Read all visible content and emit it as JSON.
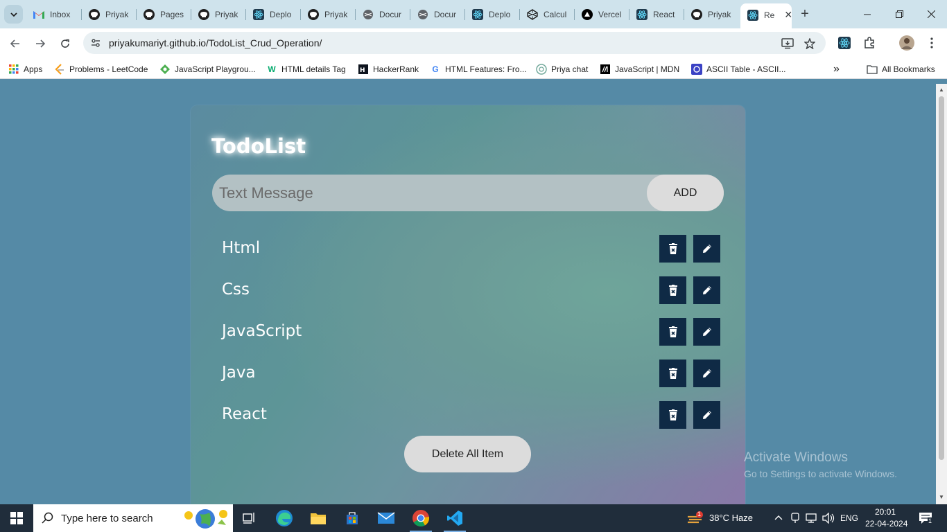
{
  "browser": {
    "tabs": [
      {
        "label": "Inbox",
        "icon": "gmail-icon"
      },
      {
        "label": "Priyak",
        "icon": "github-icon"
      },
      {
        "label": "Pages",
        "icon": "github-icon"
      },
      {
        "label": "Priyak",
        "icon": "github-icon"
      },
      {
        "label": "Deplo",
        "icon": "react-icon"
      },
      {
        "label": "Priyak",
        "icon": "github-icon"
      },
      {
        "label": "Docur",
        "icon": "globe-icon"
      },
      {
        "label": "Docur",
        "icon": "globe-icon"
      },
      {
        "label": "Deplo",
        "icon": "react-icon"
      },
      {
        "label": "Calcul",
        "icon": "codepen-icon"
      },
      {
        "label": "Vercel",
        "icon": "vercel-icon"
      },
      {
        "label": "React",
        "icon": "react-icon"
      },
      {
        "label": "Priyak",
        "icon": "github-icon"
      },
      {
        "label": "Re",
        "icon": "react-icon",
        "active": true
      }
    ],
    "new_tab": "+",
    "url": "priyakumariyt.github.io/TodoList_Crud_Operation/",
    "bookmarks": [
      {
        "label": "Apps",
        "icon": "apps-grid-icon"
      },
      {
        "label": "Problems - LeetCode",
        "icon": "leetcode-icon"
      },
      {
        "label": "JavaScript Playgrou...",
        "icon": "playground-icon"
      },
      {
        "label": "HTML details Tag",
        "icon": "w3schools-icon"
      },
      {
        "label": "HackerRank",
        "icon": "hackerrank-icon"
      },
      {
        "label": "HTML Features: Fro...",
        "icon": "google-icon"
      },
      {
        "label": "Priya chat",
        "icon": "chatgpt-icon"
      },
      {
        "label": "JavaScript | MDN",
        "icon": "mdn-icon"
      },
      {
        "label": "ASCII Table - ASCII...",
        "icon": "ascii-icon"
      }
    ],
    "more_bookmarks": "»",
    "all_bookmarks": "All Bookmarks"
  },
  "app": {
    "title": "TodoList",
    "input_placeholder": "Text Message",
    "add_label": "ADD",
    "items": [
      {
        "label": "Html"
      },
      {
        "label": "Css"
      },
      {
        "label": "JavaScript"
      },
      {
        "label": "Java"
      },
      {
        "label": "React"
      }
    ],
    "delete_all_label": "Delete All Item"
  },
  "watermark": {
    "line1": "Activate Windows",
    "line2": "Go to Settings to activate Windows."
  },
  "taskbar": {
    "search_placeholder": "Type here to search",
    "weather": "38°C  Haze",
    "weather_badge": "1",
    "language": "ENG",
    "time": "20:01",
    "date": "22-04-2024",
    "notification_count": "1"
  },
  "colors": {
    "page_bg": "#558aa6",
    "action_btn": "#0f2a45",
    "input_bg": "#b3c1c4",
    "button_bg": "#dcdcdc"
  }
}
